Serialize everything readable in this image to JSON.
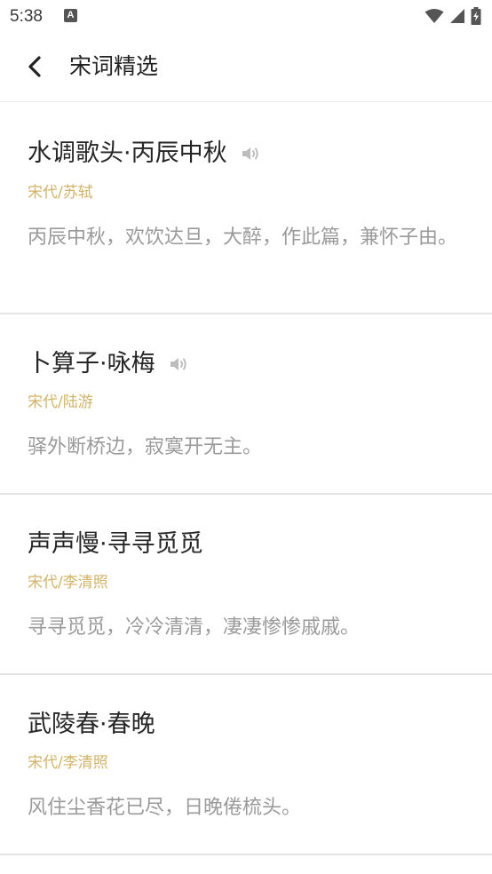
{
  "status_bar": {
    "time": "5:38",
    "notification_glyph": "A",
    "icons": [
      "wifi-icon",
      "signal-icon",
      "battery-charging-icon"
    ]
  },
  "app_bar": {
    "title": "宋词精选",
    "back_icon": "chevron-left-icon"
  },
  "poems": [
    {
      "title": "水调歌头·丙辰中秋",
      "meta": "宋代/苏轼",
      "excerpt": "丙辰中秋，欢饮达旦，大醉，作此篇，兼怀子由。",
      "has_audio": true
    },
    {
      "title": "卜算子·咏梅",
      "meta": "宋代/陆游",
      "excerpt": "驿外断桥边，寂寞开无主。",
      "has_audio": true
    },
    {
      "title": "声声慢·寻寻觅觅",
      "meta": "宋代/李清照",
      "excerpt": "寻寻觅觅，冷冷清清，凄凄惨惨戚戚。",
      "has_audio": false
    },
    {
      "title": "武陵春·春晚",
      "meta": "宋代/李清照",
      "excerpt": "风住尘香花已尽，日晚倦梳头。",
      "has_audio": false
    }
  ],
  "colors": {
    "accent_meta": "#d2b368",
    "excerpt_text": "#9a9a9a",
    "title_text": "#262626",
    "divider": "#e4e4e4"
  }
}
